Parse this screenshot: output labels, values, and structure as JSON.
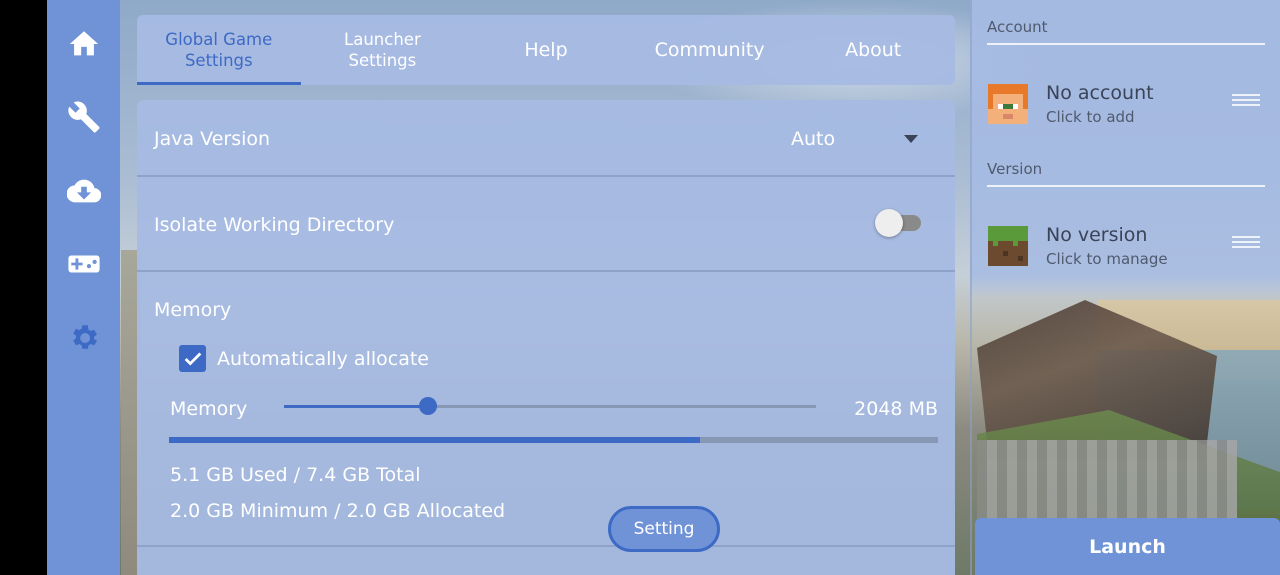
{
  "tabs": [
    {
      "label": "Global Game\nSettings",
      "active": true
    },
    {
      "label": "Launcher\nSettings",
      "active": false
    },
    {
      "label": "Help",
      "active": false
    },
    {
      "label": "Community",
      "active": false
    },
    {
      "label": "About",
      "active": false
    }
  ],
  "rail": {
    "items": [
      "home-icon",
      "wrench-icon",
      "cloud-download-icon",
      "gamepad-icon",
      "gear-icon"
    ],
    "color": "#6f93d6"
  },
  "java": {
    "label": "Java Version",
    "value": "Auto"
  },
  "isolate": {
    "label": "Isolate Working Directory",
    "enabled": false
  },
  "memory": {
    "title": "Memory",
    "auto_label": "Automatically allocate",
    "auto_checked": true,
    "slider_label": "Memory",
    "slider_value": "2048 MB",
    "slider_fraction": 0.27,
    "usage_fraction": 0.69,
    "used_text": "5.1 GB Used / 7.4 GB Total",
    "alloc_text": "2.0 GB Minimum / 2.0 GB Allocated",
    "setting_button": "Setting"
  },
  "account": {
    "section_title": "Account",
    "name": "No account",
    "sub": "Click to add"
  },
  "version": {
    "section_title": "Version",
    "name": "No version",
    "sub": "Click to manage"
  },
  "launch_label": "Launch",
  "colors": {
    "accent": "#3d6ac4",
    "panel": "#a6bbe3",
    "rail": "#6f93d6"
  }
}
